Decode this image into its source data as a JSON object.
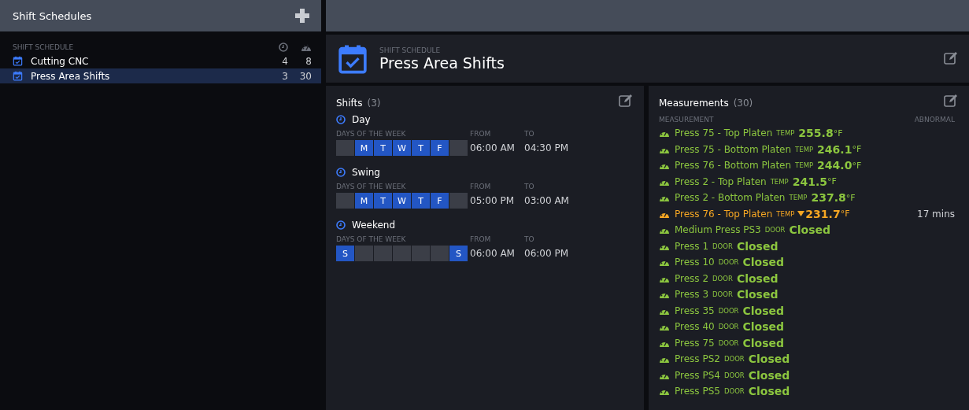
{
  "sidebar": {
    "title": "Shift Schedules",
    "columns": {
      "name": "SHIFT SCHEDULE"
    },
    "items": [
      {
        "name": "Cutting CNC",
        "shifts": "4",
        "measurements": "8",
        "selected": false
      },
      {
        "name": "Press Area Shifts",
        "shifts": "3",
        "measurements": "30",
        "selected": true
      }
    ]
  },
  "header": {
    "subtitle": "SHIFT SCHEDULE",
    "title": "Press Area Shifts"
  },
  "shifts": {
    "title": "Shifts",
    "count": "(3)",
    "items": [
      {
        "name": "Day",
        "days_label": "DAYS OF THE WEEK",
        "from_label": "FROM",
        "to_label": "TO",
        "from": "06:00 AM",
        "to": "04:30 PM",
        "days": [
          {
            "selected": false
          },
          {
            "label": "M",
            "selected": true
          },
          {
            "label": "T",
            "selected": true
          },
          {
            "label": "W",
            "selected": true
          },
          {
            "label": "T",
            "selected": true
          },
          {
            "label": "F",
            "selected": true
          },
          {
            "selected": false
          }
        ]
      },
      {
        "name": "Swing",
        "days_label": "DAYS OF THE WEEK",
        "from_label": "FROM",
        "to_label": "TO",
        "from": "05:00 PM",
        "to": "03:00 AM",
        "days": [
          {
            "selected": false
          },
          {
            "label": "M",
            "selected": true
          },
          {
            "label": "T",
            "selected": true
          },
          {
            "label": "W",
            "selected": true
          },
          {
            "label": "T",
            "selected": true
          },
          {
            "label": "F",
            "selected": true
          },
          {
            "selected": false
          }
        ]
      },
      {
        "name": "Weekend",
        "days_label": "DAYS OF THE WEEK",
        "from_label": "FROM",
        "to_label": "TO",
        "from": "06:00 AM",
        "to": "06:00 PM",
        "days": [
          {
            "label": "S",
            "selected": true
          },
          {
            "selected": false
          },
          {
            "selected": false
          },
          {
            "selected": false
          },
          {
            "selected": false
          },
          {
            "selected": false
          },
          {
            "label": "S",
            "selected": true
          }
        ]
      }
    ]
  },
  "measurements": {
    "title": "Measurements",
    "count": "(30)",
    "columns": {
      "measurement": "MEASUREMENT",
      "abnormal": "ABNORMAL"
    },
    "rows": [
      {
        "name": "Press 75 - Top Platen",
        "type": "TEMP",
        "value": "255.8",
        "unit": "°F",
        "color": "#8cc63f"
      },
      {
        "name": "Press 75 - Bottom Platen",
        "type": "TEMP",
        "value": "246.1",
        "unit": "°F",
        "color": "#8cc63f"
      },
      {
        "name": "Press 76 - Bottom Platen",
        "type": "TEMP",
        "value": "244.0",
        "unit": "°F",
        "color": "#8cc63f"
      },
      {
        "name": "Press 2 - Top Platen",
        "type": "TEMP",
        "value": "241.5",
        "unit": "°F",
        "color": "#8cc63f"
      },
      {
        "name": "Press 2 - Bottom Platen",
        "type": "TEMP",
        "value": "237.8",
        "unit": "°F",
        "color": "#8cc63f"
      },
      {
        "name": "Press 76 - Top Platen",
        "type": "TEMP",
        "value": "231.7",
        "unit": "°F",
        "color": "#f5a623",
        "falling": true,
        "abnormal": "17 mins"
      },
      {
        "name": "Medium Press PS3",
        "type": "DOOR",
        "value": "Closed",
        "color": "#8cc63f"
      },
      {
        "name": "Press 1",
        "type": "DOOR",
        "value": "Closed",
        "color": "#8cc63f"
      },
      {
        "name": "Press 10",
        "type": "DOOR",
        "value": "Closed",
        "color": "#8cc63f"
      },
      {
        "name": "Press 2",
        "type": "DOOR",
        "value": "Closed",
        "color": "#8cc63f"
      },
      {
        "name": "Press 3",
        "type": "DOOR",
        "value": "Closed",
        "color": "#8cc63f"
      },
      {
        "name": "Press 35",
        "type": "DOOR",
        "value": "Closed",
        "color": "#8cc63f"
      },
      {
        "name": "Press 40",
        "type": "DOOR",
        "value": "Closed",
        "color": "#8cc63f"
      },
      {
        "name": "Press 75",
        "type": "DOOR",
        "value": "Closed",
        "color": "#8cc63f"
      },
      {
        "name": "Press PS2",
        "type": "DOOR",
        "value": "Closed",
        "color": "#8cc63f"
      },
      {
        "name": "Press PS4",
        "type": "DOOR",
        "value": "Closed",
        "color": "#8cc63f"
      },
      {
        "name": "Press PS5",
        "type": "DOOR",
        "value": "Closed",
        "color": "#8cc63f"
      }
    ]
  }
}
